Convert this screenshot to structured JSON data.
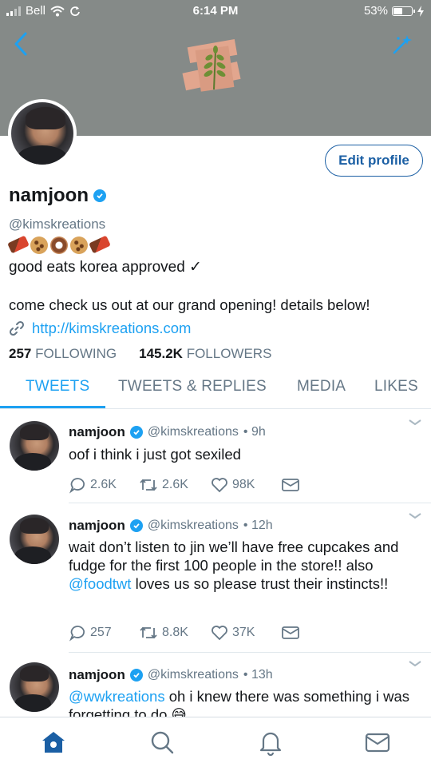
{
  "status_bar": {
    "carrier": "Bell",
    "time": "6:14 PM",
    "battery": "53%"
  },
  "profile": {
    "name": "namjoon",
    "handle": "@kimskreations",
    "edit_button": "Edit profile",
    "emoji": [
      "chocolate",
      "cookie",
      "doughnut",
      "cookie",
      "chocolate"
    ],
    "bio_line": "good eats korea approved ✓",
    "bio_text": "come check us out at our grand opening! details below!",
    "link": "http://kimskreations.com",
    "following_count": "257",
    "following_label": "FOLLOWING",
    "followers_count": "145.2K",
    "followers_label": "FOLLOWERS"
  },
  "tabs": [
    {
      "label": "TWEETS",
      "active": true
    },
    {
      "label": "TWEETS & REPLIES",
      "active": false
    },
    {
      "label": "MEDIA",
      "active": false
    },
    {
      "label": "LIKES",
      "active": false
    }
  ],
  "tweets": [
    {
      "name": "namjoon",
      "handle": "@kimskreations",
      "time": "• 9h",
      "text": "oof i think i just got sexiled",
      "replies": "2.6K",
      "retweets": "2.6K",
      "likes": "98K"
    },
    {
      "name": "namjoon",
      "handle": "@kimskreations",
      "time": "• 12h",
      "text_a": "wait don’t listen to jin we’ll have free cupcakes and fudge for the first 100 people in the store!! also ",
      "mention": "@foodtwt",
      "text_b": " loves us so please trust their instincts!!",
      "replies": "257",
      "retweets": "8.8K",
      "likes": "37K"
    },
    {
      "name": "namjoon",
      "handle": "@kimskreations",
      "time": "• 13h",
      "mention": "@wwkreations",
      "text_b": " oh i knew there was something i was forgetting to do 😅"
    }
  ],
  "icons": {
    "back": "chevron-left-icon",
    "compose": "sparkle-icon",
    "reply": "speech-bubble-icon",
    "retweet": "retweet-icon",
    "like": "heart-icon",
    "dm": "envelope-icon",
    "home": "home-icon",
    "search": "search-icon",
    "notifications": "bell-icon",
    "messages": "envelope-icon"
  },
  "colors": {
    "accent": "#1da1f2",
    "edit_button": "#1b5fa4",
    "banner": "#858a88",
    "home_active": "#1b5fa4"
  }
}
